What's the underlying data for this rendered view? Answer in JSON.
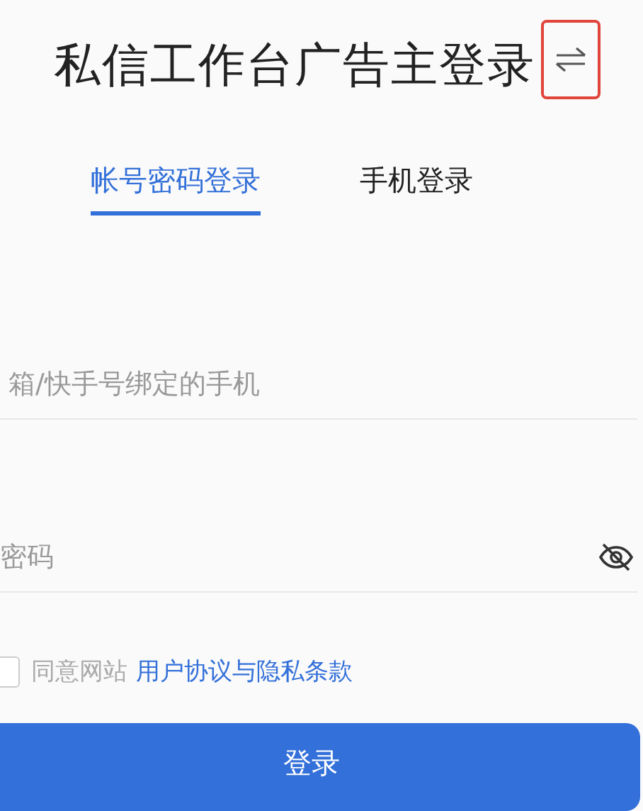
{
  "title": "私信工作台广告主登录",
  "tabs": [
    {
      "label": "帐号密码登录",
      "selected": true
    },
    {
      "label": "手机登录",
      "selected": false
    }
  ],
  "account_field": {
    "placeholder": "箱/快手号绑定的手机"
  },
  "password_field": {
    "placeholder": "密码"
  },
  "agreement": {
    "checked": false,
    "text": "同意网站",
    "link": "用户协议与隐私条款"
  },
  "login_button": "登录"
}
